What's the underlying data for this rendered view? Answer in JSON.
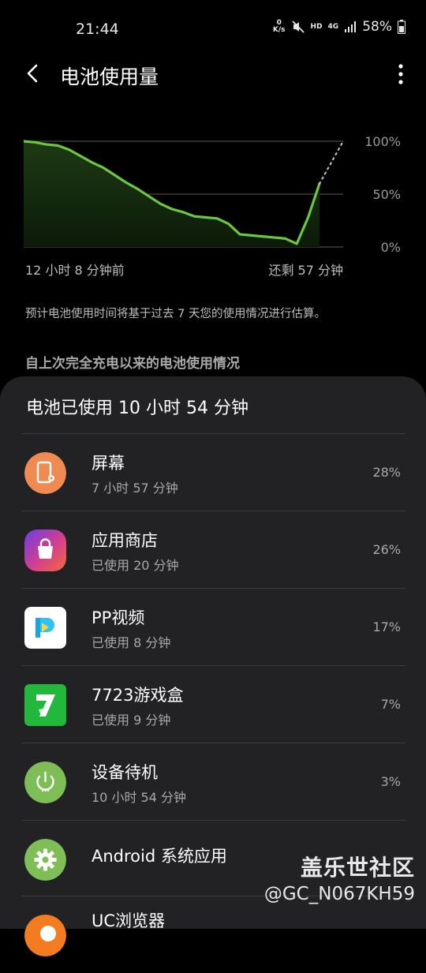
{
  "status": {
    "time": "21:44",
    "net_speed_top": "0",
    "net_speed_bottom": "K/s",
    "hd": "HD",
    "net": "4G",
    "battery": "58%"
  },
  "header": {
    "title": "电池使用量"
  },
  "chart": {
    "y_labels": [
      "100%",
      "50%",
      "0%"
    ],
    "start_label": "12 小时 8 分钟前",
    "end_label": "还剩 57 分钟"
  },
  "note": "预计电池使用时间将基于过去 7 天您的使用情况进行估算。",
  "section_title": "自上次完全充电以来的电池使用情况",
  "sheet": {
    "title": "电池已使用 10 小时 54 分钟"
  },
  "apps": [
    {
      "name": "屏幕",
      "sub": "7 小时 57 分钟",
      "pct": "28%",
      "icon": "screen-icon"
    },
    {
      "name": "应用商店",
      "sub": "已使用 20 分钟",
      "pct": "26%",
      "icon": "galaxy-store-icon"
    },
    {
      "name": "PP视频",
      "sub": "已使用 8 分钟",
      "pct": "17%",
      "icon": "pp-video-icon"
    },
    {
      "name": "7723游戏盒",
      "sub": "已使用 9 分钟",
      "pct": "7%",
      "icon": "game-box-icon"
    },
    {
      "name": "设备待机",
      "sub": "10 小时 54 分钟",
      "pct": "3%",
      "icon": "power-icon"
    },
    {
      "name": "Android 系统应用",
      "sub": "",
      "pct": "",
      "icon": "settings-icon"
    },
    {
      "name": "UC浏览器",
      "sub": "",
      "pct": "",
      "icon": "uc-browser-icon"
    }
  ],
  "watermark": {
    "line1": "盖乐世社区",
    "line2": "@GC_N067KH59"
  },
  "colors": {
    "accent": "#6cc644",
    "sheet": "#222224"
  },
  "chart_data": {
    "type": "line",
    "x_label_start": "12 小时 8 分钟前",
    "x_label_end": "还剩 57 分钟",
    "ylim": [
      0,
      100
    ],
    "y_ticks": [
      "100%",
      "50%",
      "0%"
    ],
    "series": [
      {
        "values": [
          100,
          99,
          97,
          96,
          92,
          86,
          80,
          75,
          68,
          61,
          55,
          48,
          41,
          36,
          33,
          29,
          28,
          27,
          22,
          12,
          11,
          10,
          9,
          8,
          3,
          28,
          60
        ]
      },
      {
        "values": [
          60,
          100
        ]
      }
    ]
  }
}
